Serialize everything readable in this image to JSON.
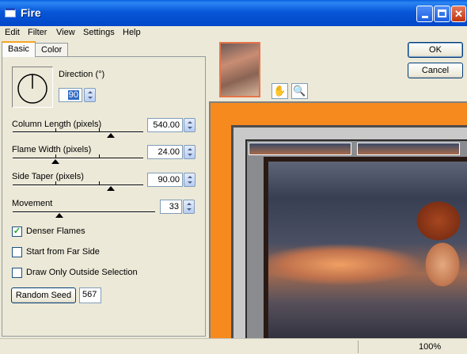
{
  "window": {
    "title": "Fire"
  },
  "menu": [
    "Edit",
    "Filter",
    "View",
    "Settings",
    "Help"
  ],
  "tabs": {
    "basic": "Basic",
    "color": "Color"
  },
  "direction": {
    "label": "Direction (°)",
    "value": "90"
  },
  "column_length": {
    "label": "Column Length (pixels)",
    "value": "540.00",
    "level": 0.75
  },
  "flame_width": {
    "label": "Flame Width (pixels)",
    "value": "24.00",
    "level": 0.33
  },
  "side_taper": {
    "label": "Side Taper (pixels)",
    "value": "90.00",
    "level": 0.75
  },
  "movement": {
    "label": "Movement",
    "value": "33",
    "level": 0.33
  },
  "options": {
    "denser_flames": {
      "label": "Denser Flames",
      "checked": true
    },
    "start_far_side": {
      "label": "Start from Far Side",
      "checked": false
    },
    "outside_selection": {
      "label": "Draw Only Outside Selection",
      "checked": false
    }
  },
  "random_seed": {
    "label": "Random Seed",
    "value": "567"
  },
  "buttons": {
    "ok": "OK",
    "cancel": "Cancel"
  },
  "status": {
    "zoom": "100%"
  },
  "icons": {
    "hand": "hand-pan-icon",
    "zoom": "magnifier-icon"
  }
}
